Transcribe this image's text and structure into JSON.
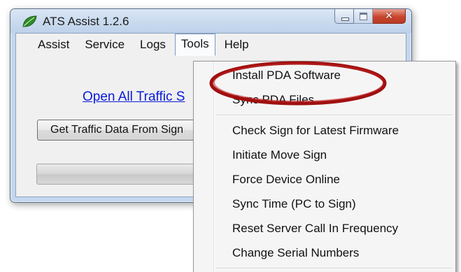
{
  "window": {
    "title": "ATS Assist 1.2.6",
    "close_glyph": "✕",
    "icon": "leaf-icon",
    "accent_color": "#c4d7ee",
    "close_color": "#c9452d"
  },
  "menubar": {
    "items": [
      {
        "label": "Assist"
      },
      {
        "label": "Service"
      },
      {
        "label": "Logs"
      },
      {
        "label": "Tools",
        "active": true
      },
      {
        "label": "Help"
      }
    ]
  },
  "main": {
    "link_text": "Open All Traffic S",
    "button_label": "Get Traffic Data From Sign",
    "progress": 0
  },
  "tools_menu": {
    "items": [
      {
        "label": "Install PDA Software",
        "highlighted": true
      },
      {
        "label": "Sync PDA Files"
      },
      {
        "label": "Check Sign for Latest Firmware"
      },
      {
        "label": "Initiate Move Sign"
      },
      {
        "label": "Force Device Online"
      },
      {
        "label": "Sync Time (PC to Sign)"
      },
      {
        "label": "Reset Server Call In Frequency"
      },
      {
        "label": "Change Serial Numbers"
      }
    ]
  },
  "annotation": {
    "ring_color": "#a01010"
  }
}
